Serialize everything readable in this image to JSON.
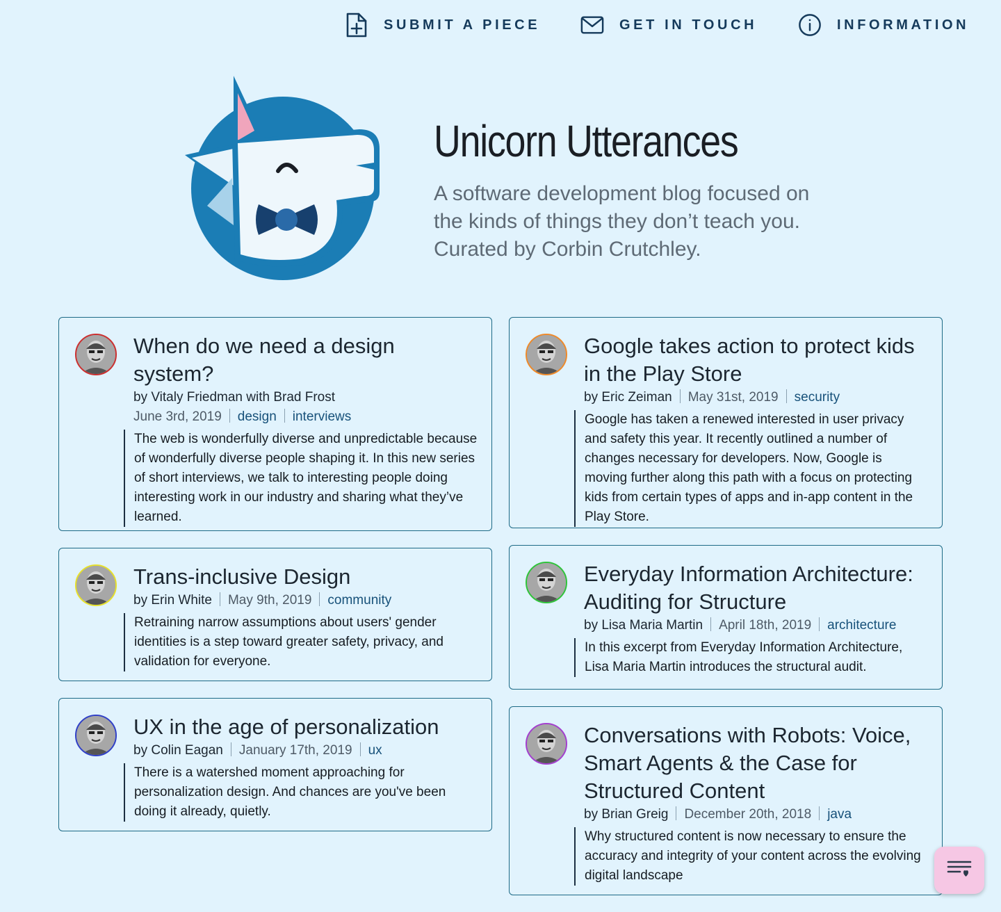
{
  "nav": {
    "submit": {
      "label": "Submit a piece",
      "icon": "file-plus-icon"
    },
    "contact": {
      "label": "Get in touch",
      "icon": "mail-icon"
    },
    "info": {
      "label": "Information",
      "icon": "info-icon"
    }
  },
  "hero": {
    "title": "Unicorn Utterances",
    "description": "A software development blog focused on the kinds of things they don’t teach you. Curated by Corbin Crutchley.",
    "logo": "unicorn-logo"
  },
  "posts": [
    {
      "title": "When do we need a design system?",
      "byline": "by Vitaly Friedman with Brad Frost",
      "date": "June 3rd, 2019",
      "tags": [
        "design",
        "interviews"
      ],
      "excerpt": "The web is wonderfully diverse and unpredictable because of wonderfully diverse people shaping it. In this new series of short interviews, we talk to interesting people doing interesting work in our industry and sharing what they’ve learned.",
      "avatar_ring": "#cc2f2f"
    },
    {
      "title": "Google takes action to protect kids in the Play Store",
      "byline": "by Eric Zeiman",
      "date": "May 31st, 2019",
      "tags": [
        "security"
      ],
      "excerpt": "Google has taken a renewed interested in user privacy and safety this year. It recently outlined a number of changes necessary for developers. Now, Google is moving further along this path with a focus on protecting kids from certain types of apps and in-app content in the Play Store.",
      "avatar_ring": "#ef8a2a"
    },
    {
      "title": "Trans-inclusive Design",
      "byline": "by Erin White",
      "date": "May 9th, 2019",
      "tags": [
        "community"
      ],
      "excerpt": "Retraining narrow assumptions about users' gender identities is a step toward greater safety, privacy, and validation for everyone.",
      "avatar_ring": "#e7e02b"
    },
    {
      "title": "Everyday Information Architecture: Auditing for Structure",
      "byline": "by Lisa Maria Martin",
      "date": "April 18th, 2019",
      "tags": [
        "architecture"
      ],
      "excerpt": "In this excerpt from Everyday Information Architecture, Lisa Maria Martin introduces the structural audit.",
      "avatar_ring": "#2fc43a"
    },
    {
      "title": "UX in the age of personalization",
      "byline": "by Colin Eagan",
      "date": "January 17th, 2019",
      "tags": [
        "ux"
      ],
      "excerpt": "There is a watershed moment approaching for personalization design. And chances are you've been doing it already, quietly.",
      "avatar_ring": "#3040c8"
    },
    {
      "title": "Conversations with Robots: Voice, Smart Agents & the Case for Structured Content",
      "byline": "by Brian Greig",
      "date": "December 20th, 2018",
      "tags": [
        "java"
      ],
      "excerpt": "Why structured content is now necessary to ensure the accuracy and integrity of your content across the evolving digital landscape",
      "avatar_ring": "#a33fcf"
    }
  ],
  "fab": {
    "icon": "filter-list-heart-icon",
    "color": "#f6c7e4"
  },
  "colors": {
    "background": "#e1f3fd",
    "accent": "#17517a",
    "card_border": "#1d6a86"
  }
}
